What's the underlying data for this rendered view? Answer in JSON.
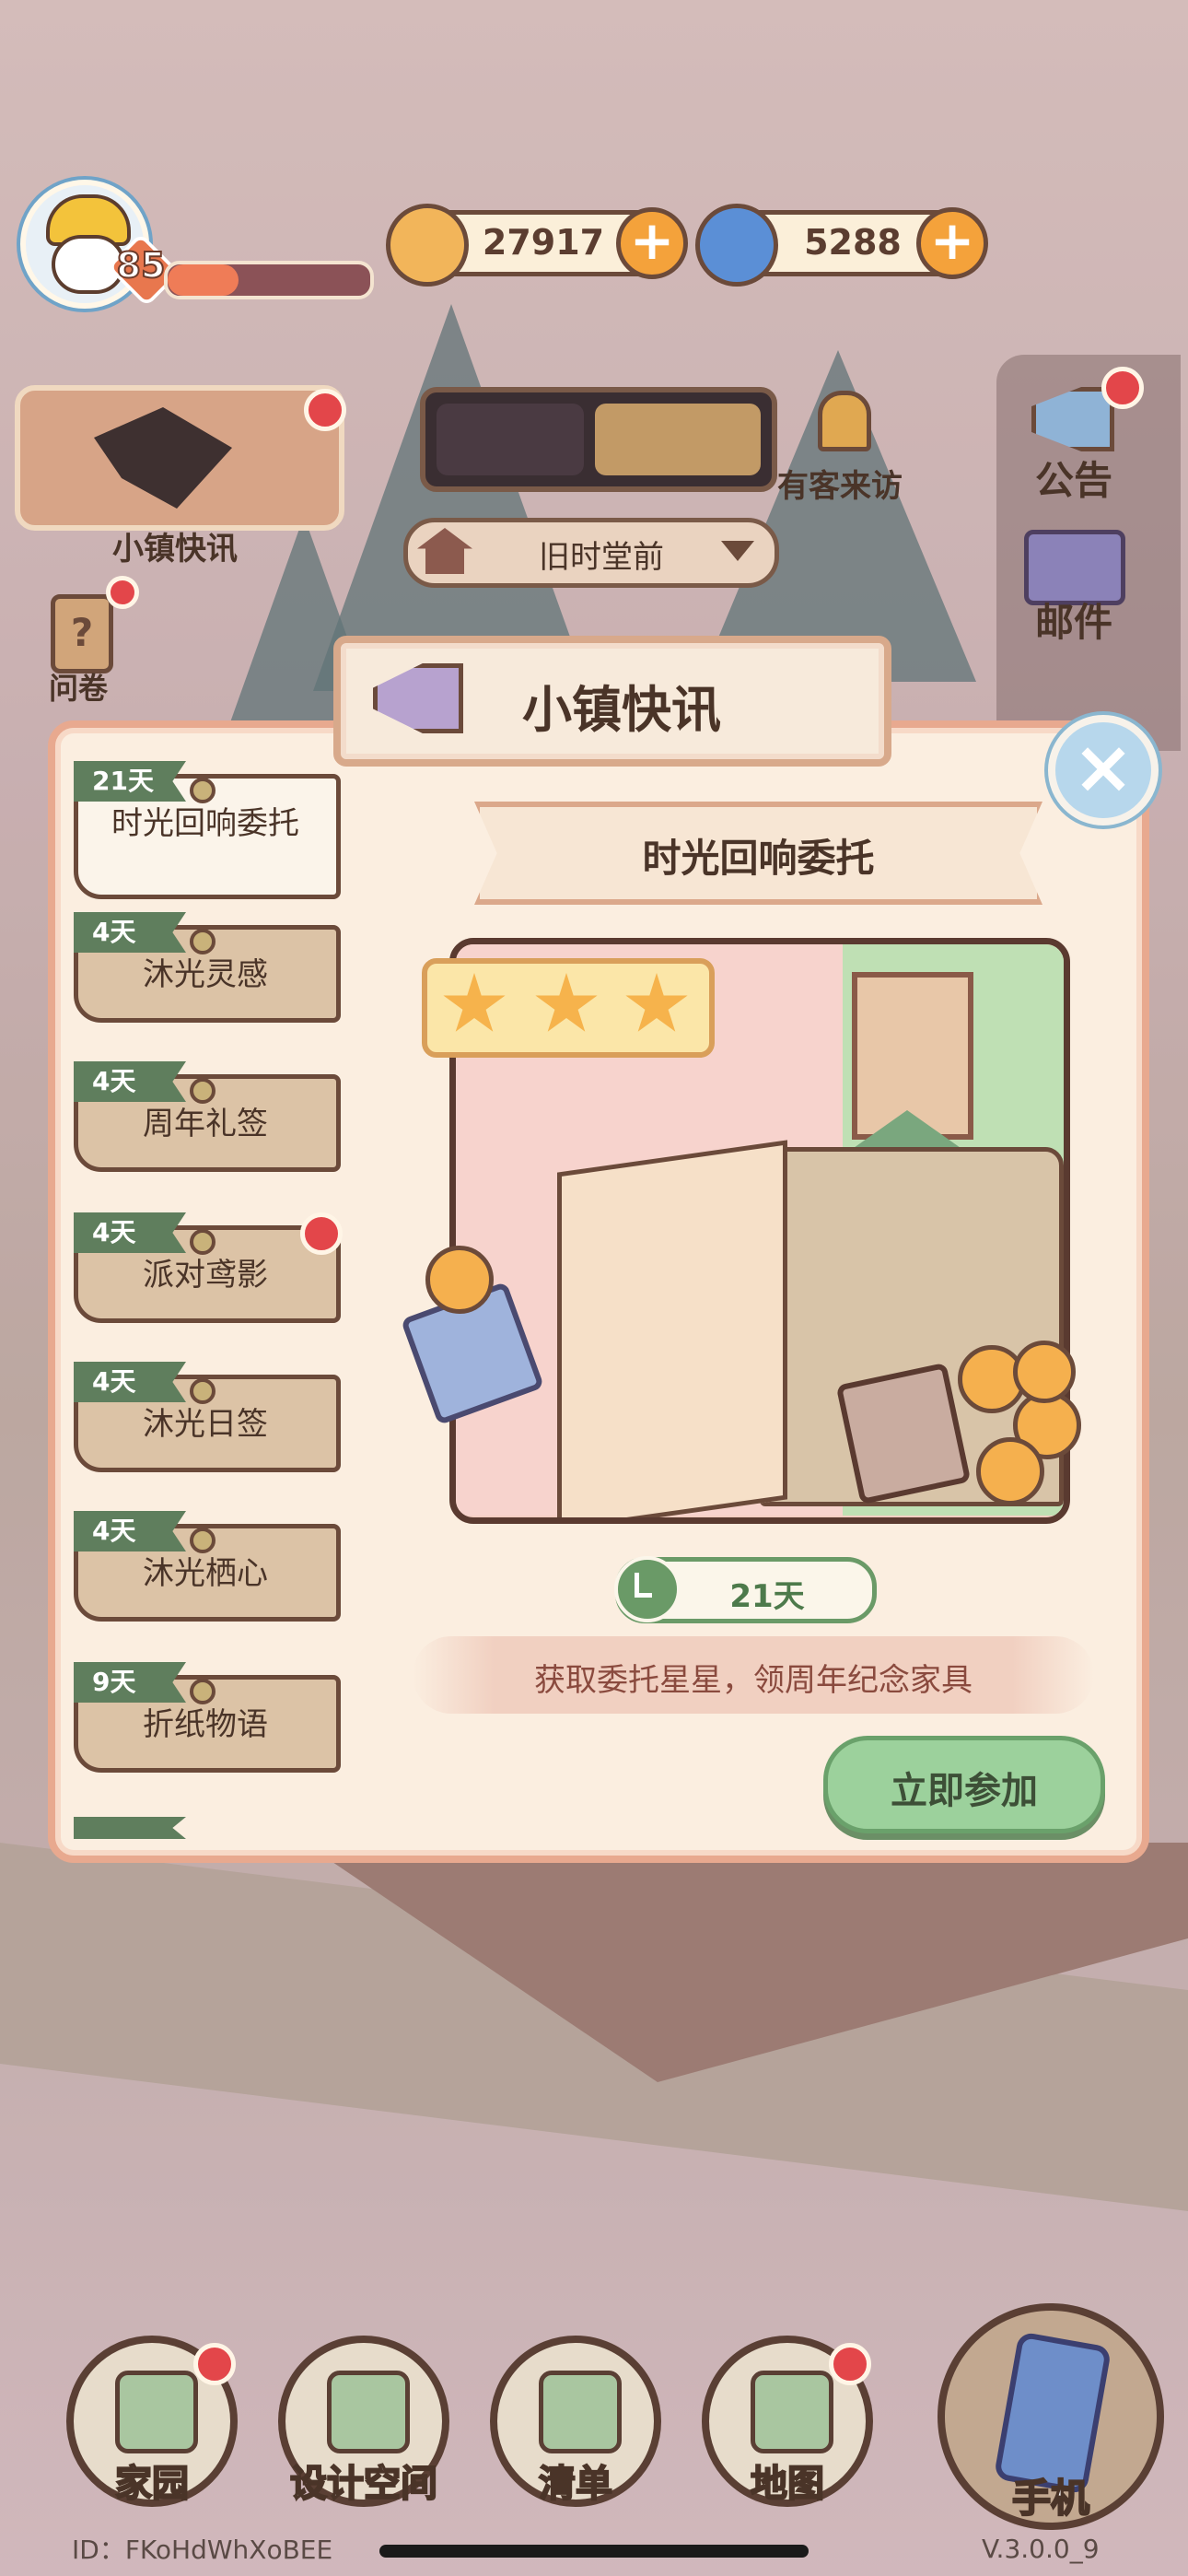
{
  "hud": {
    "level": "85",
    "level_progress": 0.35,
    "coins": "27917",
    "gems": "5288",
    "coin_icon": "coin-icon",
    "gem_icon": "swirl-gem-icon"
  },
  "side_left": {
    "news_label": "小镇快讯",
    "survey_label": "问卷"
  },
  "top_center": {
    "scene_name": "旧时堂前",
    "visitor_label": "有客来访"
  },
  "side_right": {
    "announce_label": "公告",
    "mail_label": "邮件"
  },
  "modal": {
    "title": "小镇快讯",
    "tabs": [
      {
        "days": "21天",
        "label": "时光回响委托",
        "active": true,
        "badge": false
      },
      {
        "days": "4天",
        "label": "沐光灵感",
        "active": false,
        "badge": false
      },
      {
        "days": "4天",
        "label": "周年礼签",
        "active": false,
        "badge": false
      },
      {
        "days": "4天",
        "label": "派对鸢影",
        "active": false,
        "badge": true
      },
      {
        "days": "4天",
        "label": "沐光日签",
        "active": false,
        "badge": false
      },
      {
        "days": "4天",
        "label": "沐光栖心",
        "active": false,
        "badge": false
      },
      {
        "days": "9天",
        "label": "折纸物语",
        "active": false,
        "badge": false
      }
    ],
    "event": {
      "title": "时光回响委托",
      "remaining": "21天",
      "description": "获取委托星星，领周年纪念家具",
      "join_label": "立即参加",
      "stars": 3
    }
  },
  "bottom_nav": [
    {
      "label": "家园",
      "icon": "home-icon",
      "badge": true
    },
    {
      "label": "设计空间",
      "icon": "design-icon",
      "badge": false
    },
    {
      "label": "清单",
      "icon": "checklist-icon",
      "badge": false
    },
    {
      "label": "地图",
      "icon": "map-pin-icon",
      "badge": true
    }
  ],
  "phone_label": "手机",
  "footer": {
    "uid": "ID：FKoHdWhXoBEE",
    "version": "V.3.0.0_9"
  },
  "colors": {
    "accent_green": "#9cd19c",
    "badge_red": "#e3464a",
    "modal_border": "#e8a98f",
    "day_tag": "#5f7e5d"
  }
}
